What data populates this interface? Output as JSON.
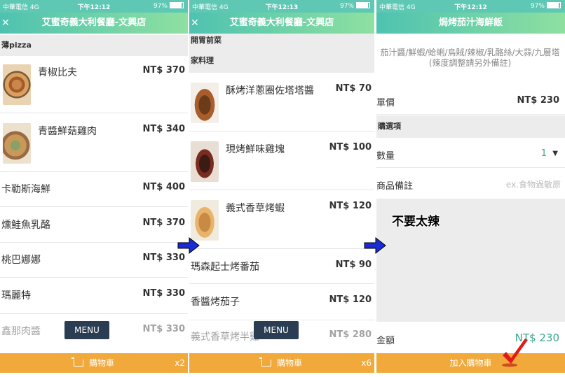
{
  "status_bar": {
    "carrier": "中華電信 4G",
    "battery": "97%"
  },
  "panel1": {
    "time": "下午12:12",
    "title": "艾蜜奇義大利餐廳-文興店",
    "back_icon": "close-icon",
    "section": "薄pizza",
    "items": [
      {
        "name": "青椒比夫",
        "price": "NT$ 370"
      },
      {
        "name": "青醬鮮菇雞肉",
        "price": "NT$ 340"
      },
      {
        "name": "卡勒斯海鮮",
        "price": "NT$ 400"
      },
      {
        "name": "燻鮭魚乳酪",
        "price": "NT$ 370"
      },
      {
        "name": "桃巴娜娜",
        "price": "NT$ 330"
      },
      {
        "name": "瑪麗特",
        "price": "NT$ 330"
      },
      {
        "name": "鑫那肉醬",
        "price": "NT$ 330"
      }
    ],
    "menu_label": "MENU",
    "cart_label": "購物車",
    "cart_count": "x2"
  },
  "panel2": {
    "time": "下午12:13",
    "title": "艾蜜奇義大利餐廳-文興店",
    "back_icon": "close-icon",
    "section_top": "開胃前菜",
    "section": "家料理",
    "items": [
      {
        "name": "酥烤洋蔥圈佐塔塔醬",
        "price": "NT$ 70"
      },
      {
        "name": "現烤鮮味雞塊",
        "price": "NT$ 100"
      },
      {
        "name": "義式香草烤蝦",
        "price": "NT$ 120"
      },
      {
        "name": "瑪森起士烤番茄",
        "price": "NT$ 90"
      },
      {
        "name": "香醬烤茄子",
        "price": "NT$ 120"
      },
      {
        "name": "義式香草烤半雞",
        "price": "NT$ 280"
      }
    ],
    "menu_label": "MENU",
    "cart_label": "購物車",
    "cart_count": "x6"
  },
  "panel3": {
    "time": "下午12:12",
    "title": "焗烤茄汁海鮮飯",
    "description_line1": "茄汁醬/鮮蝦/蛤蜊/烏賊/辣椒/乳酪絲/大蒜/九層塔",
    "description_line2": "(辣度調整請另外備註)",
    "price_label": "單價",
    "price_value": "NT$ 230",
    "options_section": "購選項",
    "qty_label": "數量",
    "qty_value": "1",
    "note_label": "商品備註",
    "note_placeholder": "ex.食物過敏原",
    "note_text": "不要太辣",
    "total_label": "金額",
    "total_value": "NT$ 230",
    "add_to_cart": "加入購物車"
  },
  "colors": {
    "header_gradient_start": "#4ec2b0",
    "header_gradient_end": "#8ee0a0",
    "cart_bar": "#f0a93a",
    "menu_button": "#2b3d52",
    "accent_green": "#3aa88e",
    "arrow_blue": "#1a2bd6",
    "check_red": "#e01b1b"
  }
}
